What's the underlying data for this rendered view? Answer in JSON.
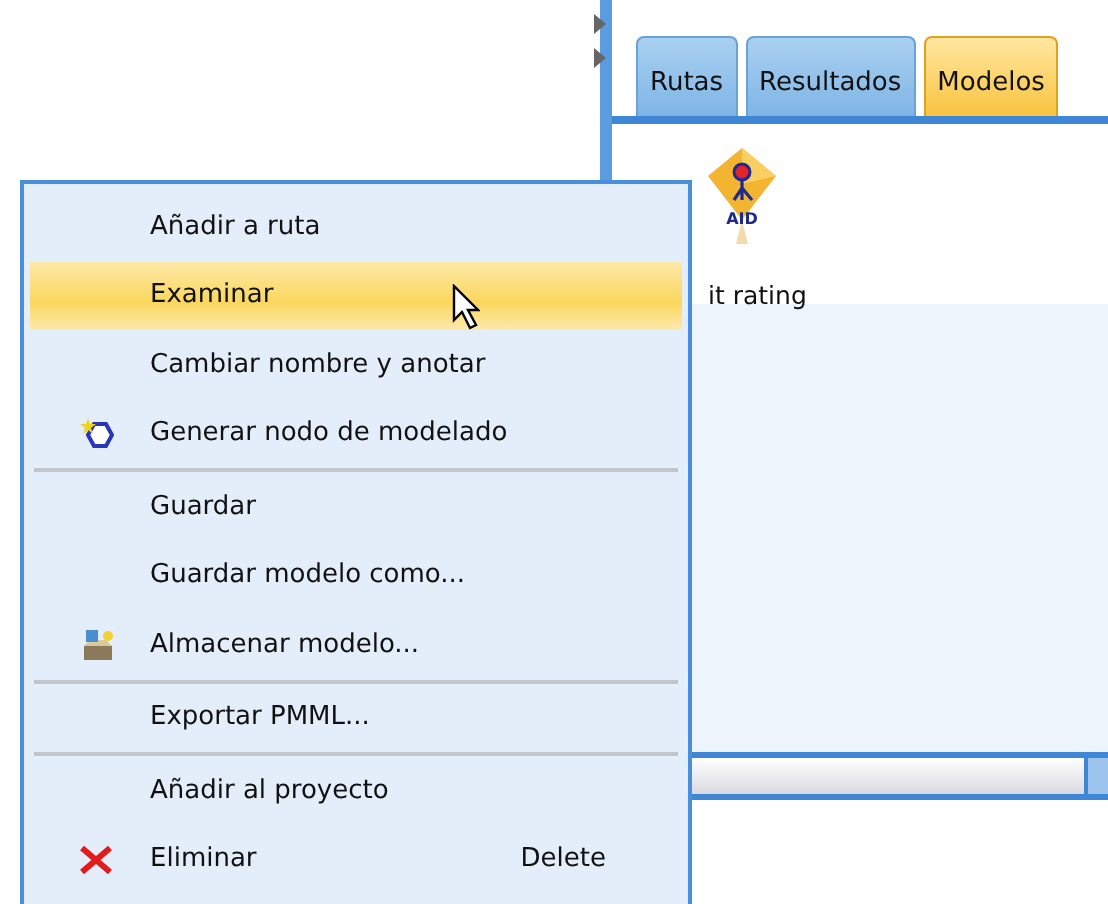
{
  "tabs": [
    {
      "label": "Rutas",
      "selected": false
    },
    {
      "label": "Resultados",
      "selected": false
    },
    {
      "label": "Modelos",
      "selected": true
    }
  ],
  "model_node": {
    "icon_text": "AID",
    "label": "it rating"
  },
  "context_menu": {
    "items": [
      {
        "kind": "item",
        "label": "Añadir a ruta",
        "selected": false
      },
      {
        "kind": "item",
        "label": "Examinar",
        "selected": true
      },
      {
        "kind": "item",
        "label": "Cambiar nombre y anotar",
        "selected": false
      },
      {
        "kind": "generate",
        "label": "Generar nodo de modelado",
        "selected": false
      },
      {
        "kind": "separator"
      },
      {
        "kind": "item",
        "label": "Guardar",
        "selected": false
      },
      {
        "kind": "item",
        "label": "Guardar modelo como...",
        "selected": false
      },
      {
        "kind": "store",
        "label": "Almacenar modelo...",
        "selected": false
      },
      {
        "kind": "separator"
      },
      {
        "kind": "item",
        "label": "Exportar PMML...",
        "selected": false
      },
      {
        "kind": "separator"
      },
      {
        "kind": "item",
        "label": "Añadir al proyecto",
        "selected": false
      },
      {
        "kind": "delete",
        "label": "Eliminar",
        "selected": false,
        "shortcut": "Delete"
      }
    ]
  }
}
